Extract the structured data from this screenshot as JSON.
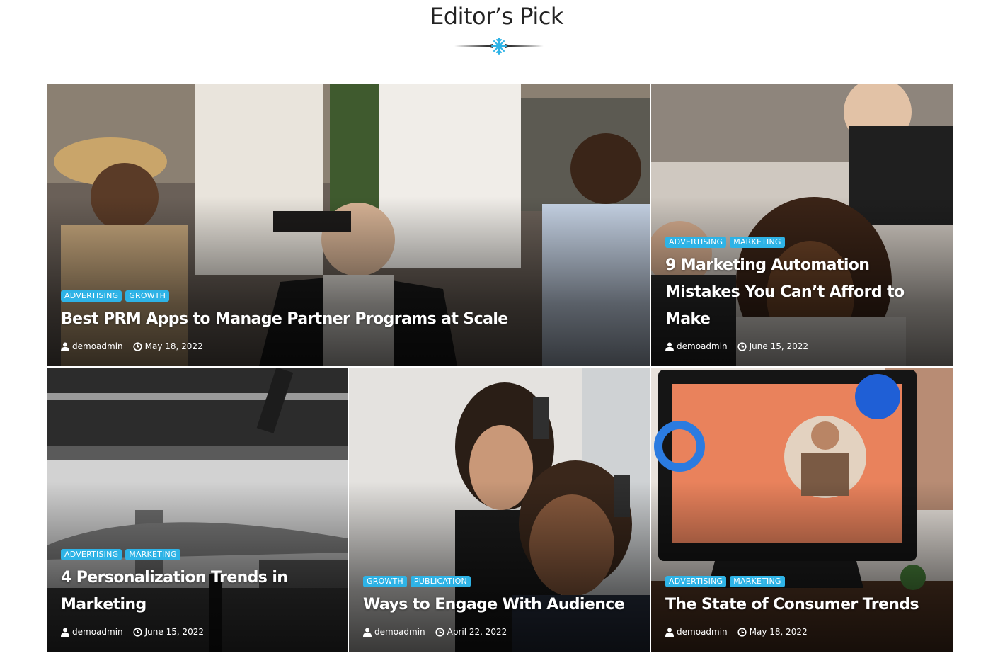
{
  "section": {
    "title": "Editor’s Pick"
  },
  "colors": {
    "accent": "#2eb3e6",
    "title_text": "#222222"
  },
  "cards": [
    {
      "tags": [
        "ADVERTISING",
        "GROWTH"
      ],
      "title": "Best PRM Apps to Manage Partner Programs at Scale",
      "author": "demoadmin",
      "date": "May 18, 2022"
    },
    {
      "tags": [
        "ADVERTISING",
        "MARKETING"
      ],
      "title": "9 Marketing Automation Mistakes You Can’t Afford to Make",
      "author": "demoadmin",
      "date": "June 15, 2022"
    },
    {
      "tags": [
        "ADVERTISING",
        "MARKETING"
      ],
      "title": "4 Personalization Trends in Marketing",
      "author": "demoadmin",
      "date": "June 15, 2022"
    },
    {
      "tags": [
        "GROWTH",
        "PUBLICATION"
      ],
      "title": "Ways to Engage With Audience",
      "author": "demoadmin",
      "date": "April 22, 2022"
    },
    {
      "tags": [
        "ADVERTISING",
        "MARKETING"
      ],
      "title": "The State of Consumer Trends",
      "author": "demoadmin",
      "date": "May 18, 2022"
    }
  ]
}
